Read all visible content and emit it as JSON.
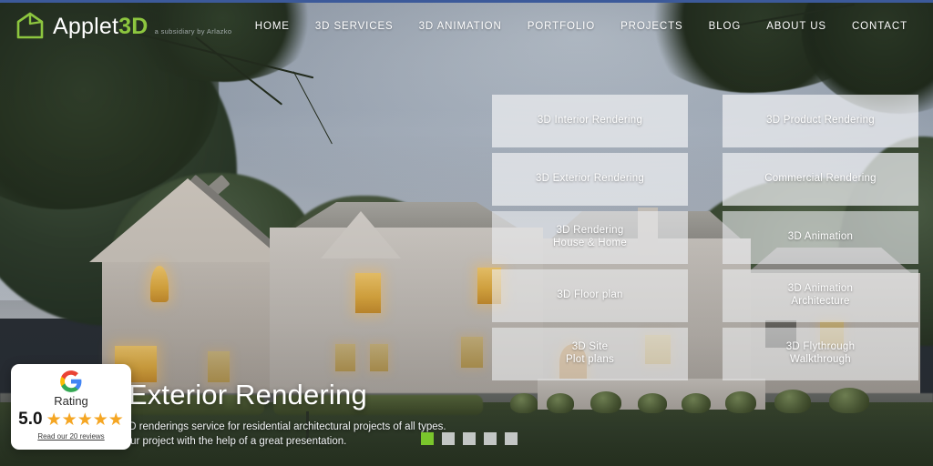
{
  "site": {
    "brand_primary": "Applet",
    "brand_accent": "3D",
    "brand_subtitle": "a subsidiary by Arlazko",
    "accent_color": "#8dc63f",
    "active_dot_color": "#7ac62c",
    "top_bar_color": "#3c5a9a"
  },
  "nav": {
    "items": [
      {
        "label": "HOME"
      },
      {
        "label": "3D SERVICES"
      },
      {
        "label": "3D ANIMATION"
      },
      {
        "label": "PORTFOLIO"
      },
      {
        "label": "PROJECTS"
      },
      {
        "label": "BLOG"
      },
      {
        "label": "ABOUT US"
      },
      {
        "label": "CONTACT"
      }
    ]
  },
  "services": {
    "rows": [
      {
        "left": {
          "label": "3D Interior Rendering"
        },
        "right": {
          "label": "3D Product Rendering"
        }
      },
      {
        "left": {
          "label": "3D Exterior Rendering"
        },
        "right": {
          "label": "Commercial Rendering"
        }
      },
      {
        "left": {
          "label": "3D Rendering\nHouse & Home"
        },
        "right": {
          "label": "3D Animation"
        }
      },
      {
        "left": {
          "label": "3D Floor plan"
        },
        "right": {
          "label": "3D Animation\nArchitecture"
        }
      },
      {
        "left": {
          "label": "3D Site\nPlot plans"
        },
        "right": {
          "label": "3D Flythrough\nWalkthrough"
        }
      }
    ]
  },
  "hero": {
    "title": "3D Exterior Rendering",
    "subtitle_line1": "Exterior 3D renderings service for residential architectural projects of all types.",
    "subtitle_line2": "Win on your project with the help of a great presentation."
  },
  "pagination": {
    "total": 5,
    "active_index": 0
  },
  "google_badge": {
    "logo_letter": "G",
    "rating_label": "Rating",
    "score": "5.0",
    "star_glyph": "★",
    "star_count": 5,
    "reviews_link": "Read our 20 reviews"
  }
}
